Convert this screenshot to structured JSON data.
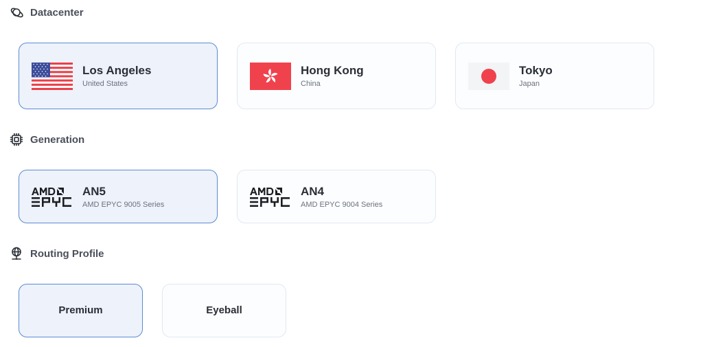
{
  "datacenter": {
    "heading": "Datacenter",
    "icon": "planet-icon",
    "options": [
      {
        "title": "Los Angeles",
        "subtitle": "United States",
        "flag": "us-flag",
        "selected": true
      },
      {
        "title": "Hong Kong",
        "subtitle": "China",
        "flag": "hk-flag",
        "selected": false
      },
      {
        "title": "Tokyo",
        "subtitle": "Japan",
        "flag": "jp-flag",
        "selected": false
      }
    ]
  },
  "generation": {
    "heading": "Generation",
    "icon": "cpu-chip-icon",
    "options": [
      {
        "title": "AN5",
        "subtitle": "AMD EPYC 9005 Series",
        "logo": "amd-epyc-logo",
        "selected": true
      },
      {
        "title": "AN4",
        "subtitle": "AMD EPYC 9004 Series",
        "logo": "amd-epyc-logo",
        "selected": false
      }
    ]
  },
  "routing": {
    "heading": "Routing Profile",
    "icon": "globe-network-icon",
    "options": [
      {
        "title": "Premium",
        "selected": true
      },
      {
        "title": "Eyeball",
        "selected": false
      }
    ]
  },
  "colors": {
    "selected_bg": "#edf2fb",
    "selected_border": "#5b8ad2",
    "card_border": "#e1e8f2",
    "hk_red": "#f0424d",
    "jp_red": "#f0424d"
  }
}
